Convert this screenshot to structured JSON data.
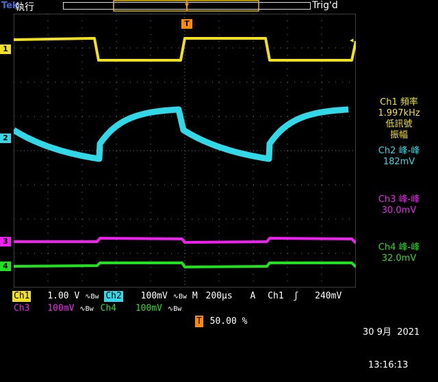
{
  "header": {
    "brand": "Tek",
    "mode": "執行",
    "trigger_status": "Trig'd",
    "trigger_marker": "T"
  },
  "channels": [
    {
      "id": "ch1",
      "marker": "1",
      "color": "#f0e020"
    },
    {
      "id": "ch2",
      "marker": "2",
      "color": "#30d8e8"
    },
    {
      "id": "ch3",
      "marker": "3",
      "color": "#f020f0"
    },
    {
      "id": "ch4",
      "marker": "4",
      "color": "#20e020"
    }
  ],
  "measurements": {
    "ch1": {
      "line1": "Ch1 頻率",
      "line2": "1.997kHz",
      "line3": "低訊號",
      "line4": "振幅"
    },
    "ch2": {
      "line1": "Ch2 峰-峰",
      "line2": "182mV"
    },
    "ch3": {
      "line1": "Ch3 峰-峰",
      "line2": "30.0mV"
    },
    "ch4": {
      "line1": "Ch4 峰-峰",
      "line2": "32.0mV"
    }
  },
  "status_bar": {
    "ch1_label": "Ch1",
    "ch1_scale": "1.00 V",
    "ch2_label": "Ch2",
    "ch2_scale": "100mV",
    "ch3_label": "Ch3",
    "ch3_scale": "100mV",
    "ch4_label": "Ch4",
    "ch4_scale": "100mV",
    "bw_symbol": "∿Bw",
    "timebase_label": "M",
    "timebase": "200µs",
    "acq_label": "A",
    "trigger_source": "Ch1",
    "trigger_slope": "ʃ",
    "trigger_level": "240mV",
    "trigger_pos_marker": "T",
    "trigger_position": "50.00 %",
    "date": "30 9月  2021",
    "time": "13:16:13"
  }
}
